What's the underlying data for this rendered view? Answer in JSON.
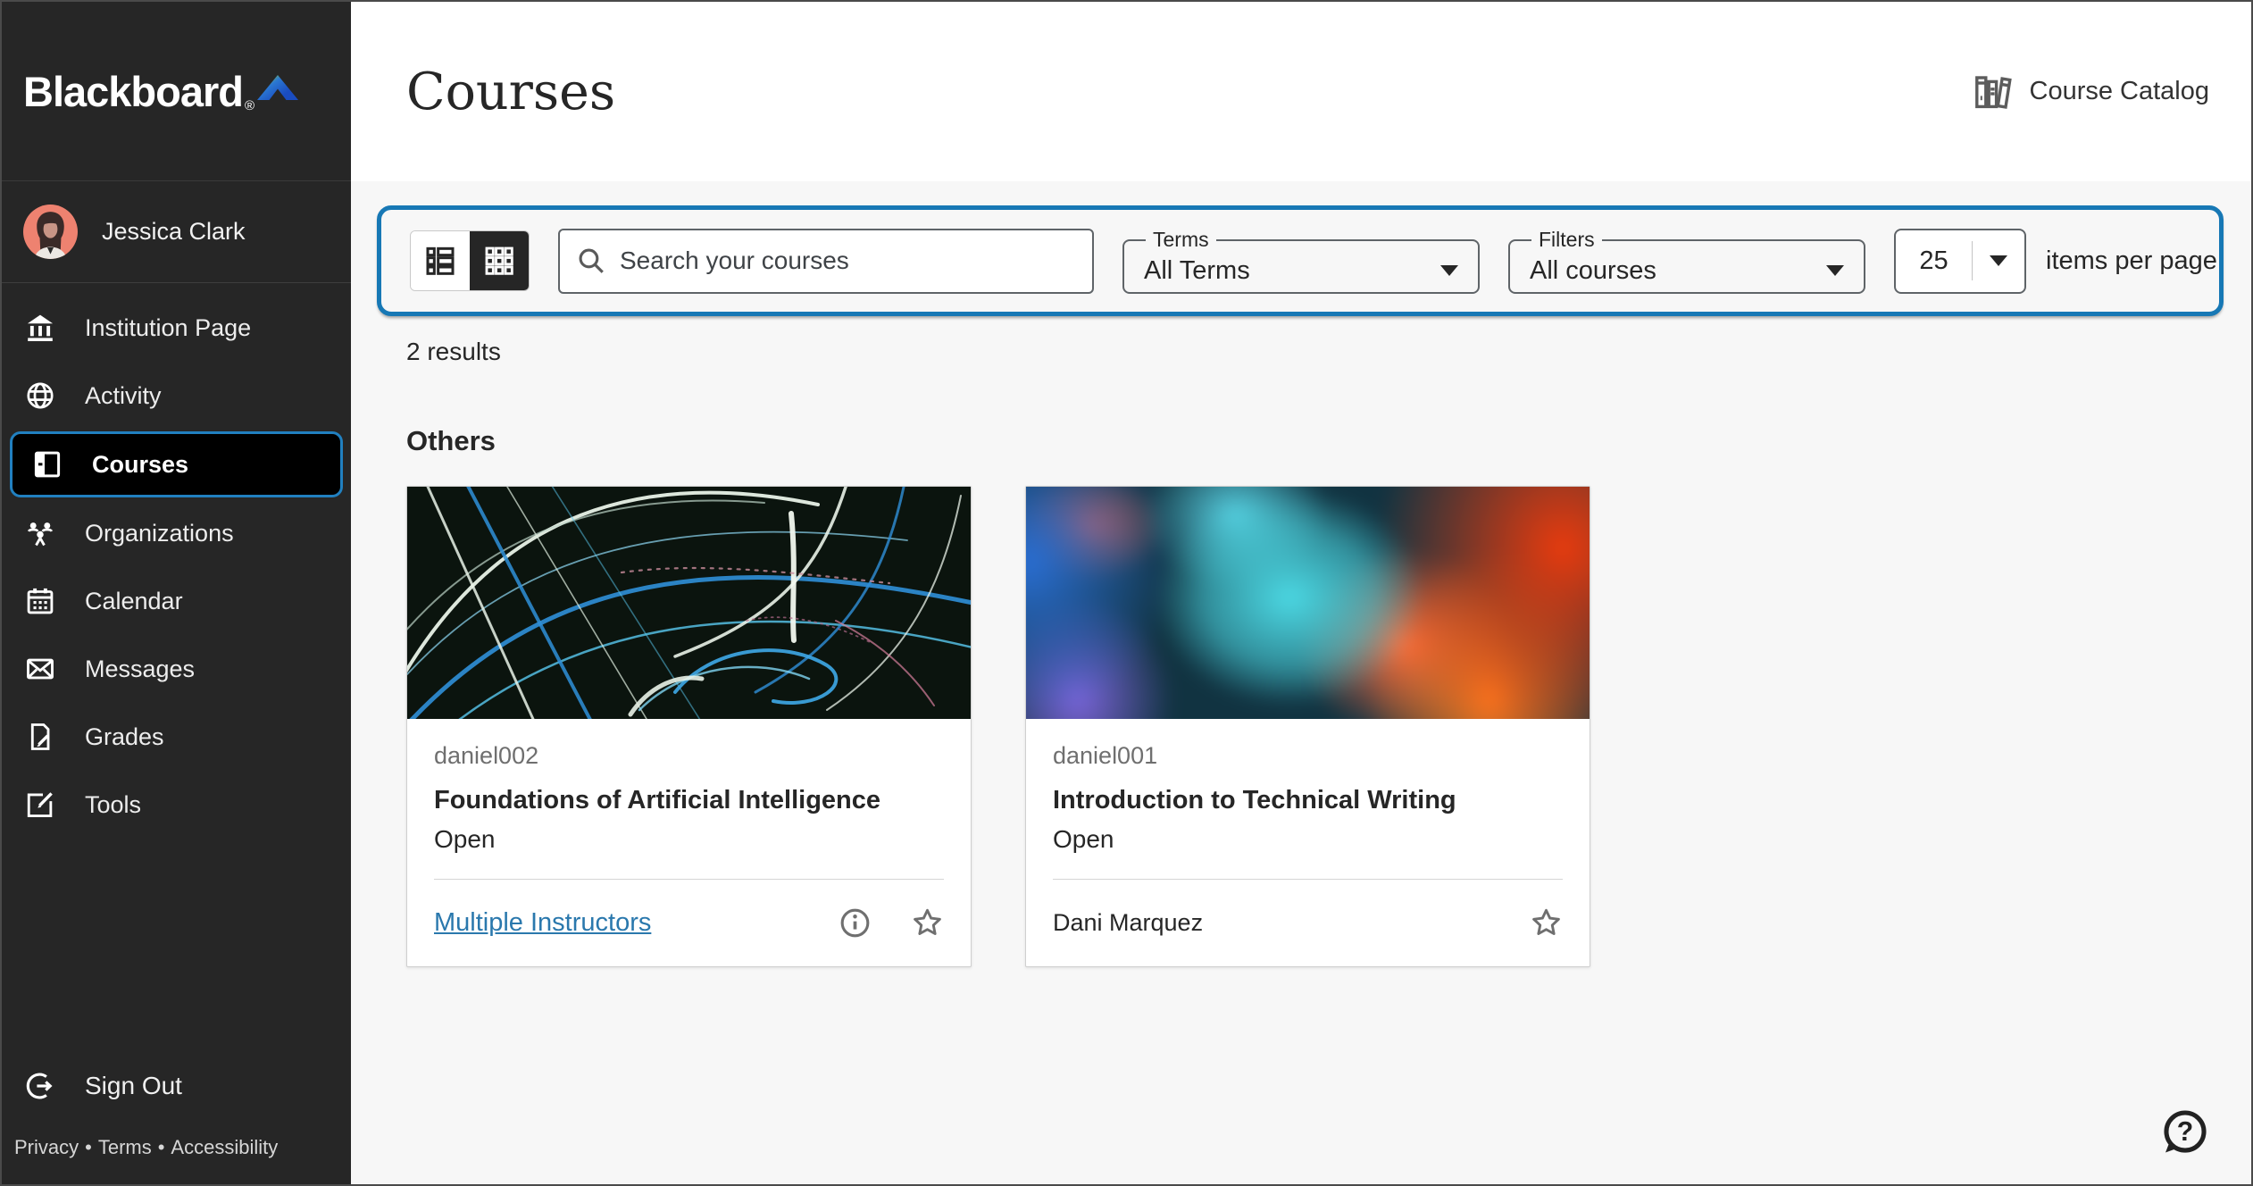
{
  "brand": {
    "name": "Blackboard",
    "registered_mark": "®"
  },
  "sidebar": {
    "user_name": "Jessica Clark",
    "items": [
      {
        "label": "Institution Page"
      },
      {
        "label": "Activity"
      },
      {
        "label": "Courses"
      },
      {
        "label": "Organizations"
      },
      {
        "label": "Calendar"
      },
      {
        "label": "Messages"
      },
      {
        "label": "Grades"
      },
      {
        "label": "Tools"
      }
    ],
    "selected_item": "Courses",
    "sign_out_label": "Sign Out",
    "footer": {
      "links": [
        {
          "label": "Privacy"
        },
        {
          "label": "Terms"
        },
        {
          "label": "Accessibility"
        }
      ],
      "separator": "•"
    }
  },
  "header": {
    "title": "Courses",
    "course_catalog_label": "Course Catalog"
  },
  "filter_bar": {
    "search": {
      "placeholder": "Search your courses"
    },
    "terms": {
      "label": "Terms",
      "value": "All Terms"
    },
    "filters": {
      "label": "Filters",
      "value": "All courses"
    },
    "page_size": {
      "value": "25",
      "label": "items per page"
    }
  },
  "results_summary": "2 results",
  "section_title": "Others",
  "courses": [
    {
      "id": "daniel002",
      "title": "Foundations of Artificial Intelligence",
      "status": "Open",
      "instructor": "Multiple Instructors"
    },
    {
      "id": "daniel001",
      "title": "Introduction to Technical Writing",
      "status": "Open",
      "instructor": "Dani Marquez"
    }
  ],
  "colors": {
    "accent": "#1778b5",
    "link": "#2a78ad",
    "sidebar_bg": "#262626",
    "selected_bg": "#000000",
    "content_bg": "#f7f7f7"
  }
}
